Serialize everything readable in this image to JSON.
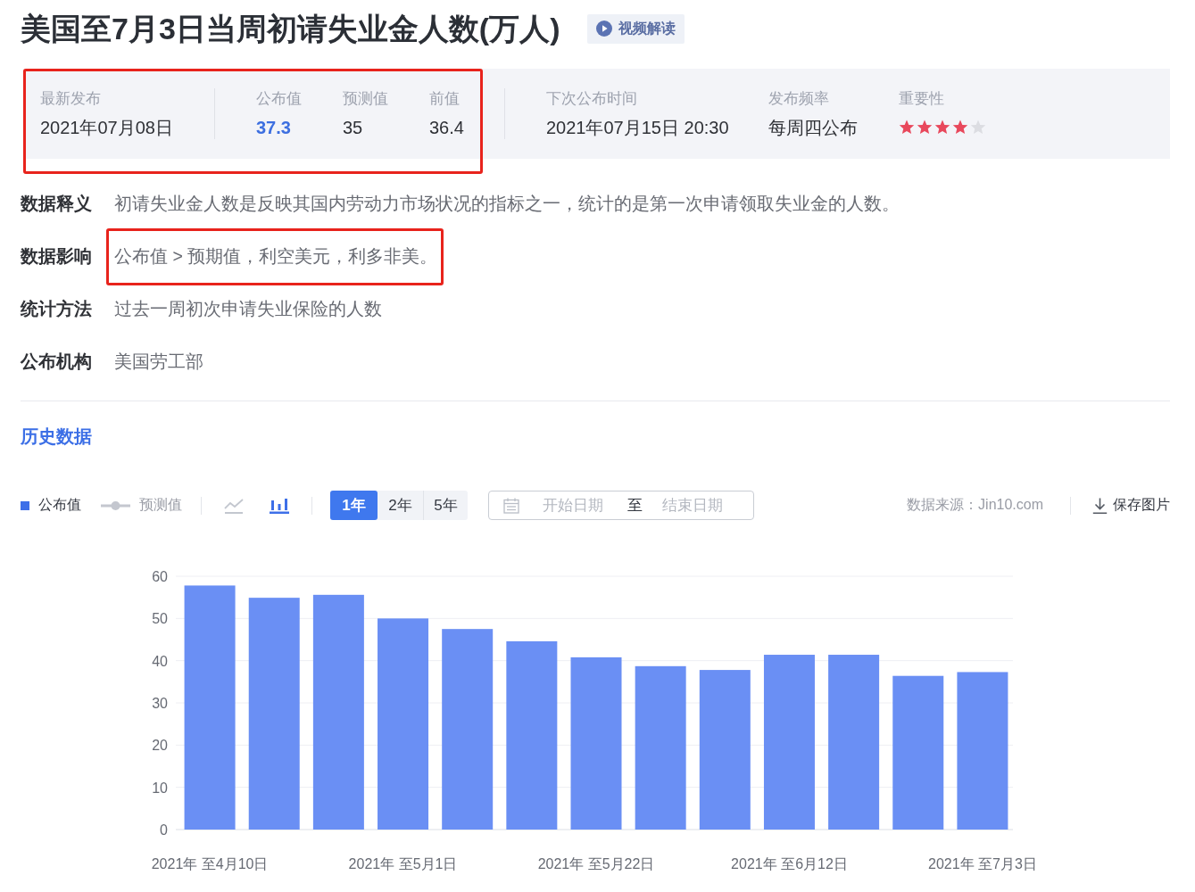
{
  "header": {
    "title": "美国至7月3日当周初请失业金人数(万人)",
    "video_button": {
      "label": "视频解读"
    }
  },
  "info": {
    "highlighted": true,
    "latest": {
      "label": "最新发布",
      "value": "2021年07月08日"
    },
    "figures": [
      {
        "kind": "actual",
        "label": "公布值",
        "value": "37.3"
      },
      {
        "kind": "forecast",
        "label": "预测值",
        "value": "35"
      },
      {
        "kind": "previous",
        "label": "前值",
        "value": "36.4"
      }
    ],
    "schedule": [
      {
        "label": "下次公布时间",
        "value": "2021年07月15日 20:30"
      },
      {
        "label": "发布频率",
        "value": "每周四公布"
      }
    ],
    "importance": {
      "label": "重要性",
      "stars": 4
    }
  },
  "details": [
    {
      "label": "数据释义",
      "value": "初请失业金人数是反映其国内劳动力市场状况的指标之一，统计的是第一次申请领取失业金的人数。",
      "highlighted": false
    },
    {
      "label": "数据影响",
      "value": "公布值 > 预期值，利空美元，利多非美。",
      "highlighted": true
    },
    {
      "label": "统计方法",
      "value": "过去一周初次申请失业保险的人数",
      "highlighted": false
    },
    {
      "label": "公布机构",
      "value": "美国劳工部",
      "highlighted": false
    }
  ],
  "history": {
    "title": "历史数据",
    "legend": [
      {
        "kind": "bar",
        "label": "公布值",
        "on": true
      },
      {
        "kind": "line",
        "label": "预测值",
        "on": false
      }
    ],
    "chart_types": [
      {
        "kind": "line",
        "selected": false
      },
      {
        "kind": "bar",
        "selected": true
      }
    ],
    "ranges": [
      {
        "label": "1年",
        "selected": true
      },
      {
        "label": "2年",
        "selected": false
      },
      {
        "label": "5年",
        "selected": false
      }
    ],
    "date_range": {
      "start_placeholder": "开始日期",
      "separator": "至",
      "end_placeholder": "结束日期"
    },
    "source": "数据来源：Jin10.com",
    "save_button": {
      "label": "保存图片"
    },
    "chart_data": {
      "type": "bar",
      "categories": [
        "2021年 至4月10日",
        null,
        null,
        "2021年 至5月1日",
        null,
        null,
        "2021年 至5月22日",
        null,
        null,
        "2021年 至6月12日",
        null,
        null,
        "2021年 至7月3日"
      ],
      "values": [
        57.8,
        54.9,
        55.6,
        50.0,
        47.5,
        44.6,
        40.8,
        38.7,
        37.8,
        41.4,
        41.4,
        36.4,
        37.3
      ],
      "ylim": [
        0,
        60
      ],
      "yticks": [
        0,
        10,
        20,
        30,
        40,
        50,
        60
      ],
      "grid": true
    }
  }
}
